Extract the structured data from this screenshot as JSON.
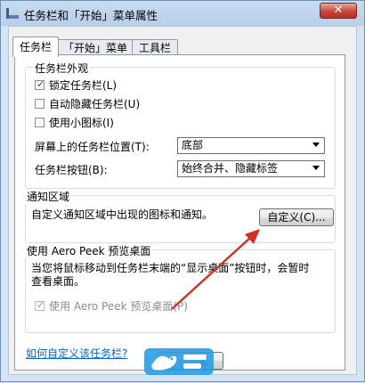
{
  "window": {
    "title": "任务栏和「开始」菜单属性",
    "close_label": "✕"
  },
  "tabs": [
    {
      "label": "任务栏",
      "active": true
    },
    {
      "label": "「开始」菜单",
      "active": false
    },
    {
      "label": "工具栏",
      "active": false
    }
  ],
  "appearance": {
    "legend": "任务栏外观",
    "lock_label": "锁定任务栏(L)",
    "lock_checked": true,
    "autohide_label": "自动隐藏任务栏(U)",
    "autohide_checked": false,
    "small_icons_label": "使用小图标(I)",
    "small_icons_checked": false,
    "position_label": "屏幕上的任务栏位置(T):",
    "position_value": "底部",
    "buttons_label": "任务栏按钮(B):",
    "buttons_value": "始终合并、隐藏标签"
  },
  "notify": {
    "legend": "通知区域",
    "description": "自定义通知区域中出现的图标和通知。",
    "customize_label": "自定义(C)..."
  },
  "peek": {
    "legend": "使用 Aero Peek 预览桌面",
    "description_line1": "当您将鼠标移动到任务栏末端的“显示桌面”按钮时，会暂时",
    "description_line2": "查看桌面。",
    "checkbox_label": "使用 Aero Peek 预览桌面(P)",
    "checkbox_checked": true
  },
  "help_link": "如何自定义该任务栏?",
  "footer": {
    "ok_partial": "定"
  },
  "icons": {
    "check_glyph": "✓",
    "arrow": "red-arrow-annotation",
    "watermark": "bird-logo-watermark"
  },
  "colors": {
    "arrow": "#d42e25",
    "link": "#0066cc",
    "watermark": "#2b9de3"
  }
}
